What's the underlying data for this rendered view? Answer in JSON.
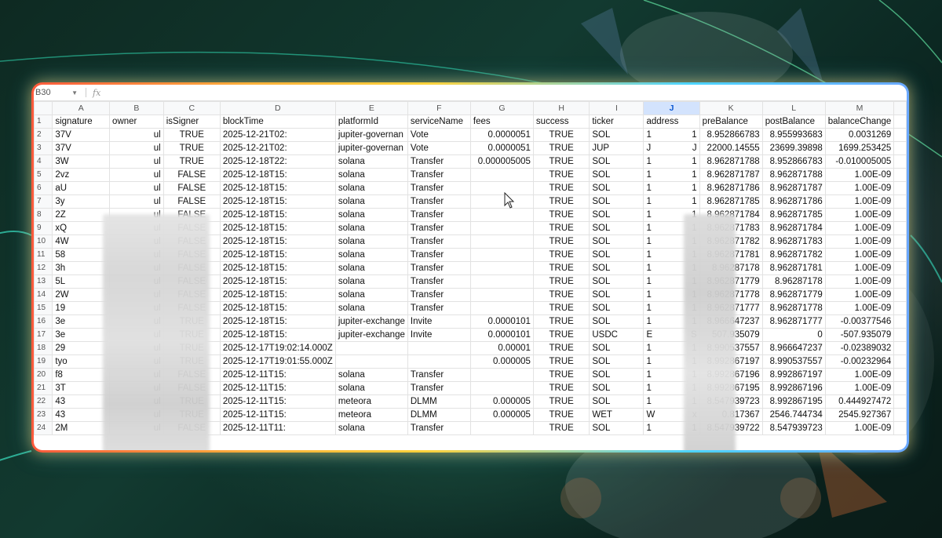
{
  "name_box": "B30",
  "fx_label": "fx",
  "columns": [
    "A",
    "B",
    "C",
    "D",
    "E",
    "F",
    "G",
    "H",
    "I",
    "J",
    "K",
    "L",
    "M"
  ],
  "selected_column": "J",
  "headers": [
    "signature",
    "owner",
    "isSigner",
    "blockTime",
    "platformId",
    "serviceName",
    "fees",
    "success",
    "ticker",
    "address",
    "preBalance",
    "postBalance",
    "balanceChange"
  ],
  "rows": [
    {
      "n": "2",
      "sig": "37V",
      "own": "ul",
      "isSigner": "TRUE",
      "blockTime": "2025-12-21T02:",
      "platformId": "jupiter-governan",
      "serviceName": "Vote",
      "fees": "0.0000051",
      "success": "TRUE",
      "ticker": "SOL",
      "addr": "1",
      "addr_end": "1",
      "pre": "8.952866783",
      "post": "8.955993683",
      "change": "0.0031269"
    },
    {
      "n": "3",
      "sig": "37V",
      "own": "ul",
      "isSigner": "TRUE",
      "blockTime": "2025-12-21T02:",
      "platformId": "jupiter-governan",
      "serviceName": "Vote",
      "fees": "0.0000051",
      "success": "TRUE",
      "ticker": "JUP",
      "addr": "J",
      "addr_end": "J",
      "pre": "22000.14555",
      "post": "23699.39898",
      "change": "1699.253425"
    },
    {
      "n": "4",
      "sig": "3W",
      "own": "ul",
      "isSigner": "TRUE",
      "blockTime": "2025-12-18T22:",
      "platformId": "solana",
      "serviceName": "Transfer",
      "fees": "0.000005005",
      "success": "TRUE",
      "ticker": "SOL",
      "addr": "1",
      "addr_end": "1",
      "pre": "8.962871788",
      "post": "8.952866783",
      "change": "-0.010005005"
    },
    {
      "n": "5",
      "sig": "2vz",
      "own": "ul",
      "isSigner": "FALSE",
      "blockTime": "2025-12-18T15:",
      "platformId": "solana",
      "serviceName": "Transfer",
      "fees": "",
      "success": "TRUE",
      "ticker": "SOL",
      "addr": "1",
      "addr_end": "1",
      "pre": "8.962871787",
      "post": "8.962871788",
      "change": "1.00E-09"
    },
    {
      "n": "6",
      "sig": "aU",
      "own": "ul",
      "isSigner": "FALSE",
      "blockTime": "2025-12-18T15:",
      "platformId": "solana",
      "serviceName": "Transfer",
      "fees": "",
      "success": "TRUE",
      "ticker": "SOL",
      "addr": "1",
      "addr_end": "1",
      "pre": "8.962871786",
      "post": "8.962871787",
      "change": "1.00E-09"
    },
    {
      "n": "7",
      "sig": "3y",
      "own": "ul",
      "isSigner": "FALSE",
      "blockTime": "2025-12-18T15:",
      "platformId": "solana",
      "serviceName": "Transfer",
      "fees": "",
      "success": "TRUE",
      "ticker": "SOL",
      "addr": "1",
      "addr_end": "1",
      "pre": "8.962871785",
      "post": "8.962871786",
      "change": "1.00E-09"
    },
    {
      "n": "8",
      "sig": "2Z",
      "own": "ul",
      "isSigner": "FALSE",
      "blockTime": "2025-12-18T15:",
      "platformId": "solana",
      "serviceName": "Transfer",
      "fees": "",
      "success": "TRUE",
      "ticker": "SOL",
      "addr": "1",
      "addr_end": "1",
      "pre": "8.962871784",
      "post": "8.962871785",
      "change": "1.00E-09"
    },
    {
      "n": "9",
      "sig": "xQ",
      "own": "ul",
      "isSigner": "FALSE",
      "blockTime": "2025-12-18T15:",
      "platformId": "solana",
      "serviceName": "Transfer",
      "fees": "",
      "success": "TRUE",
      "ticker": "SOL",
      "addr": "1",
      "addr_end": "1",
      "pre": "8.962871783",
      "post": "8.962871784",
      "change": "1.00E-09"
    },
    {
      "n": "10",
      "sig": "4W",
      "own": "ul",
      "isSigner": "FALSE",
      "blockTime": "2025-12-18T15:",
      "platformId": "solana",
      "serviceName": "Transfer",
      "fees": "",
      "success": "TRUE",
      "ticker": "SOL",
      "addr": "1",
      "addr_end": "1",
      "pre": "8.962871782",
      "post": "8.962871783",
      "change": "1.00E-09"
    },
    {
      "n": "11",
      "sig": "58",
      "own": "ul",
      "isSigner": "FALSE",
      "blockTime": "2025-12-18T15:",
      "platformId": "solana",
      "serviceName": "Transfer",
      "fees": "",
      "success": "TRUE",
      "ticker": "SOL",
      "addr": "1",
      "addr_end": "1",
      "pre": "8.962871781",
      "post": "8.962871782",
      "change": "1.00E-09"
    },
    {
      "n": "12",
      "sig": "3h",
      "own": "ul",
      "isSigner": "FALSE",
      "blockTime": "2025-12-18T15:",
      "platformId": "solana",
      "serviceName": "Transfer",
      "fees": "",
      "success": "TRUE",
      "ticker": "SOL",
      "addr": "1",
      "addr_end": "1",
      "pre": "8.96287178",
      "post": "8.962871781",
      "change": "1.00E-09"
    },
    {
      "n": "13",
      "sig": "5L",
      "own": "ul",
      "isSigner": "FALSE",
      "blockTime": "2025-12-18T15:",
      "platformId": "solana",
      "serviceName": "Transfer",
      "fees": "",
      "success": "TRUE",
      "ticker": "SOL",
      "addr": "1",
      "addr_end": "1",
      "pre": "8.962871779",
      "post": "8.96287178",
      "change": "1.00E-09"
    },
    {
      "n": "14",
      "sig": "2W",
      "own": "ul",
      "isSigner": "FALSE",
      "blockTime": "2025-12-18T15:",
      "platformId": "solana",
      "serviceName": "Transfer",
      "fees": "",
      "success": "TRUE",
      "ticker": "SOL",
      "addr": "1",
      "addr_end": "1",
      "pre": "8.962871778",
      "post": "8.962871779",
      "change": "1.00E-09"
    },
    {
      "n": "15",
      "sig": "19",
      "own": "ul",
      "isSigner": "FALSE",
      "blockTime": "2025-12-18T15:",
      "platformId": "solana",
      "serviceName": "Transfer",
      "fees": "",
      "success": "TRUE",
      "ticker": "SOL",
      "addr": "1",
      "addr_end": "1",
      "pre": "8.962871777",
      "post": "8.962871778",
      "change": "1.00E-09"
    },
    {
      "n": "16",
      "sig": "3e",
      "own": "ul",
      "isSigner": "TRUE",
      "blockTime": "2025-12-18T15:",
      "platformId": "jupiter-exchange",
      "serviceName": "Invite",
      "fees": "0.0000101",
      "success": "TRUE",
      "ticker": "SOL",
      "addr": "1",
      "addr_end": "1",
      "pre": "8.966647237",
      "post": "8.962871777",
      "change": "-0.00377546"
    },
    {
      "n": "17",
      "sig": "3e",
      "own": "ul",
      "isSigner": "TRUE",
      "blockTime": "2025-12-18T15:",
      "platformId": "jupiter-exchange",
      "serviceName": "Invite",
      "fees": "0.0000101",
      "success": "TRUE",
      "ticker": "USDC",
      "addr": "E",
      "addr_end": "S",
      "pre": "507.935079",
      "post": "0",
      "change": "-507.935079"
    },
    {
      "n": "18",
      "sig": "29",
      "own": "ul",
      "isSigner": "TRUE",
      "blockTime": "2025-12-17T19:02:14.000Z",
      "platformId": "",
      "serviceName": "",
      "fees": "0.00001",
      "success": "TRUE",
      "ticker": "SOL",
      "addr": "1",
      "addr_end": "1",
      "pre": "8.990537557",
      "post": "8.966647237",
      "change": "-0.02389032"
    },
    {
      "n": "19",
      "sig": "tyo",
      "own": "ul",
      "isSigner": "TRUE",
      "blockTime": "2025-12-17T19:01:55.000Z",
      "platformId": "",
      "serviceName": "",
      "fees": "0.000005",
      "success": "TRUE",
      "ticker": "SOL",
      "addr": "1",
      "addr_end": "1",
      "pre": "8.992867197",
      "post": "8.990537557",
      "change": "-0.00232964"
    },
    {
      "n": "20",
      "sig": "f8",
      "own": "ul",
      "isSigner": "FALSE",
      "blockTime": "2025-12-11T15:",
      "platformId": "solana",
      "serviceName": "Transfer",
      "fees": "",
      "success": "TRUE",
      "ticker": "SOL",
      "addr": "1",
      "addr_end": "1",
      "pre": "8.992867196",
      "post": "8.992867197",
      "change": "1.00E-09"
    },
    {
      "n": "21",
      "sig": "3T",
      "own": "ul",
      "isSigner": "FALSE",
      "blockTime": "2025-12-11T15:",
      "platformId": "solana",
      "serviceName": "Transfer",
      "fees": "",
      "success": "TRUE",
      "ticker": "SOL",
      "addr": "1",
      "addr_end": "1",
      "pre": "8.992867195",
      "post": "8.992867196",
      "change": "1.00E-09"
    },
    {
      "n": "22",
      "sig": "43",
      "own": "ul",
      "isSigner": "TRUE",
      "blockTime": "2025-12-11T15:",
      "platformId": "meteora",
      "serviceName": "DLMM",
      "fees": "0.000005",
      "success": "TRUE",
      "ticker": "SOL",
      "addr": "1",
      "addr_end": "1",
      "pre": "8.547939723",
      "post": "8.992867195",
      "change": "0.444927472"
    },
    {
      "n": "23",
      "sig": "43",
      "own": "ul",
      "isSigner": "TRUE",
      "blockTime": "2025-12-11T15:",
      "platformId": "meteora",
      "serviceName": "DLMM",
      "fees": "0.000005",
      "success": "TRUE",
      "ticker": "WET",
      "addr": "W",
      "addr_end": "x",
      "pre": "0.817367",
      "post": "2546.744734",
      "change": "2545.927367"
    },
    {
      "n": "24",
      "sig": "2M",
      "own": "ul",
      "isSigner": "FALSE",
      "blockTime": "2025-12-11T11:",
      "platformId": "solana",
      "serviceName": "Transfer",
      "fees": "",
      "success": "TRUE",
      "ticker": "SOL",
      "addr": "1",
      "addr_end": "1",
      "pre": "8.547939722",
      "post": "8.547939723",
      "change": "1.00E-09"
    }
  ],
  "colors": {
    "selected_header_bg": "#d3e3fd",
    "selected_header_text": "#0b57d0",
    "frame_glow": "#ffb13b"
  }
}
